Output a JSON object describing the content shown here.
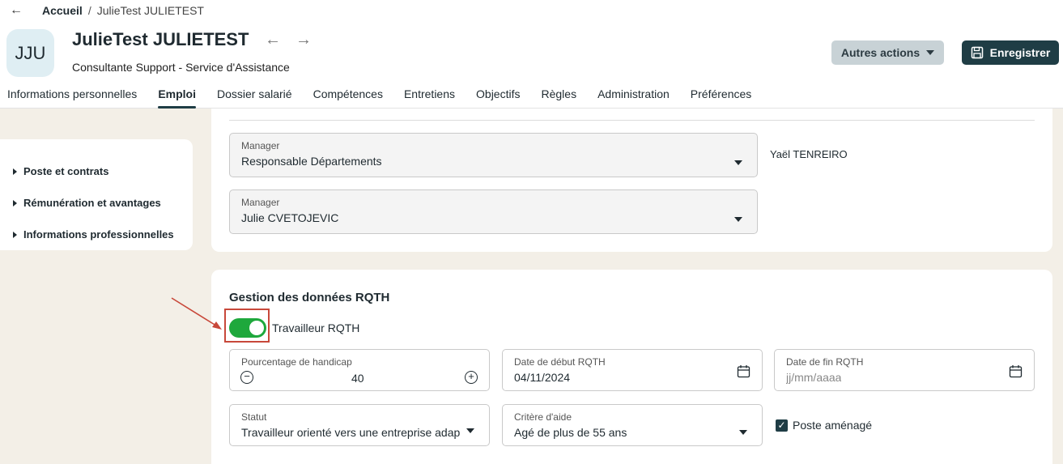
{
  "breadcrumb": {
    "back": "←",
    "home": "Accueil",
    "separator": "/",
    "current": "JulieTest JULIETEST"
  },
  "profile": {
    "initials": "JJU",
    "name": "JulieTest JULIETEST",
    "title": "Consultante Support - Service d'Assistance",
    "prev": "←",
    "next": "→"
  },
  "actions": {
    "other": "Autres actions",
    "save": "Enregistrer"
  },
  "tabs": [
    {
      "label": "Informations personnelles"
    },
    {
      "label": "Emploi",
      "active": true
    },
    {
      "label": "Dossier salarié"
    },
    {
      "label": "Compétences"
    },
    {
      "label": "Entretiens"
    },
    {
      "label": "Objectifs"
    },
    {
      "label": "Règles"
    },
    {
      "label": "Administration"
    },
    {
      "label": "Préférences"
    }
  ],
  "sidebar": {
    "items": [
      {
        "label": "Poste et contrats"
      },
      {
        "label": "Rémunération et avantages"
      },
      {
        "label": "Informations professionnelles"
      }
    ]
  },
  "managers": [
    {
      "label": "Manager",
      "value": "Responsable Départements",
      "side_name": "Yaël TENREIRO"
    },
    {
      "label": "Manager",
      "value": "Julie CVETOJEVIC"
    }
  ],
  "rqth": {
    "section_title": "Gestion des données RQTH",
    "toggle_label": "Travailleur RQTH",
    "toggle_on": true,
    "handicap": {
      "label": "Pourcentage de handicap",
      "value": "40",
      "minus": "−",
      "plus": "+"
    },
    "start_date": {
      "label": "Date de début RQTH",
      "value": "04/11/2024"
    },
    "end_date": {
      "label": "Date de fin RQTH",
      "placeholder": "jj/mm/aaaa"
    },
    "statut": {
      "label": "Statut",
      "value": "Travailleur orienté vers une entreprise adap..."
    },
    "critere": {
      "label": "Critère d'aide",
      "value": "Agé de plus de 55 ans"
    },
    "poste_amenage": {
      "label": "Poste aménagé",
      "checked": true,
      "check": "✓"
    }
  },
  "colors": {
    "primary": "#1f3d45",
    "toggle": "#1ea83c",
    "annotation": "#c8483a",
    "background": "#f3efe7"
  }
}
